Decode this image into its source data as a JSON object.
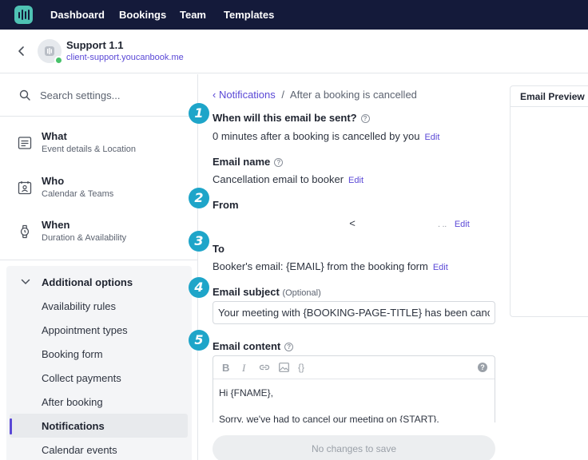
{
  "nav": {
    "links": [
      "Dashboard",
      "Bookings",
      "Team",
      "Templates"
    ]
  },
  "header": {
    "title": "Support 1.1",
    "url": "client-support.youcanbook.me"
  },
  "sidebar": {
    "search_placeholder": "Search settings...",
    "sections": [
      {
        "title": "What",
        "subtitle": "Event details & Location"
      },
      {
        "title": "Who",
        "subtitle": "Calendar & Teams"
      },
      {
        "title": "When",
        "subtitle": "Duration & Availability"
      }
    ],
    "additional_title": "Additional options",
    "items": [
      "Availability rules",
      "Appointment types",
      "Booking form",
      "Collect payments",
      "After booking",
      "Notifications",
      "Calendar events"
    ],
    "active_item": "Notifications"
  },
  "main": {
    "breadcrumb_parent": "Notifications",
    "breadcrumb_sep": "/",
    "breadcrumb_current": "After a booking is cancelled",
    "when_label": "When will this email be sent?",
    "when_value": "0 minutes after a booking is cancelled by you",
    "name_label": "Email name",
    "name_value": "Cancellation email to booker",
    "from_label": "From",
    "from_value_mid": "<",
    "from_value_end": ". ..",
    "to_label": "To",
    "to_value": "Booker's email: {EMAIL} from the booking form",
    "subject_label": "Email subject",
    "subject_optional": "(Optional)",
    "subject_value": "Your meeting with {BOOKING-PAGE-TITLE} has been cancelled",
    "content_label": "Email content",
    "content_lines": [
      "Hi {FNAME},",
      "Sorry, we've had to cancel our meeting on {START}."
    ],
    "edit_label": "Edit",
    "save_label": "No changes to save",
    "help_glyph": "?",
    "steps": [
      "1",
      "2",
      "3",
      "4",
      "5"
    ]
  },
  "toolbar": {
    "bold": "B",
    "italic": "I",
    "braces": "{}",
    "help": "?"
  },
  "preview": {
    "title": "Email Preview"
  },
  "colors": {
    "nav_bg": "#141a3a",
    "accent": "#5a48d6",
    "step_badge": "#1ea5c9",
    "online": "#47c26a"
  }
}
